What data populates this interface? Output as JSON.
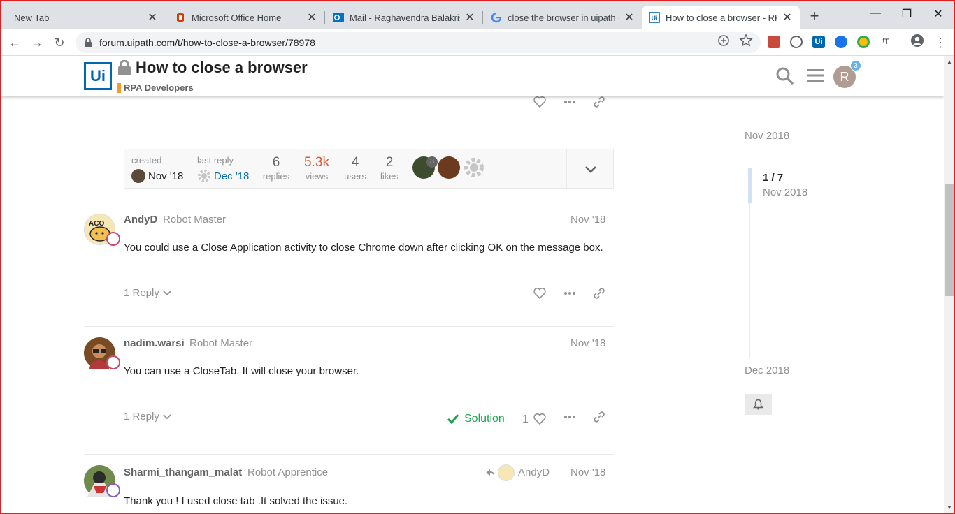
{
  "browser": {
    "tabs": [
      {
        "title": "New Tab",
        "icon": "none"
      },
      {
        "title": "Microsoft Office Home",
        "icon": "office-icon"
      },
      {
        "title": "Mail - Raghavendra Balakrishna",
        "icon": "outlook-icon"
      },
      {
        "title": "close the browser in uipath - G",
        "icon": "google-icon"
      },
      {
        "title": "How to close a browser - RPA D",
        "icon": "uipath-icon"
      }
    ],
    "new_tab": "+",
    "controls": {
      "minimize": "—",
      "restore": "❐",
      "close": "✕"
    },
    "url": "forum.uipath.com/t/how-to-close-a-browser/78978"
  },
  "header": {
    "logo": "Ui",
    "title": "How to close a browser",
    "category": "RPA Developers",
    "avatar_letter": "R",
    "notification_count": "3"
  },
  "topic_map": {
    "created_label": "created",
    "created_value": "Nov '18",
    "last_reply_label": "last reply",
    "last_reply_value": "Dec '18",
    "replies_num": "6",
    "replies_label": "replies",
    "views_num": "5.3k",
    "views_label": "views",
    "users_num": "4",
    "users_label": "users",
    "likes_num": "2",
    "likes_label": "likes",
    "participant_badge": "3"
  },
  "posts": [
    {
      "username": "AndyD",
      "user_title": "Robot Master",
      "date": "Nov '18",
      "body": "You could use a Close Application activity to close Chrome down after clicking OK on the message box.",
      "replies": "1 Reply"
    },
    {
      "username": "nadim.warsi",
      "user_title": "Robot Master",
      "date": "Nov '18",
      "body": "You can use a CloseTab. It will close your browser.",
      "replies": "1 Reply",
      "solution": "Solution",
      "likes": "1"
    },
    {
      "username": "Sharmi_thangam_malat",
      "user_title": "Robot Apprentice",
      "date": "Nov '18",
      "reply_to": "AndyD",
      "body": "Thank you ! I used close tab .It solved the issue."
    }
  ],
  "timeline": {
    "top_date": "Nov 2018",
    "position": "1 / 7",
    "position_date": "Nov 2018",
    "bottom_date": "Dec 2018"
  },
  "colors": {
    "brand": "#0067b1",
    "category": "#f79a29",
    "views": "#e45735",
    "solution": "#1ca551"
  }
}
